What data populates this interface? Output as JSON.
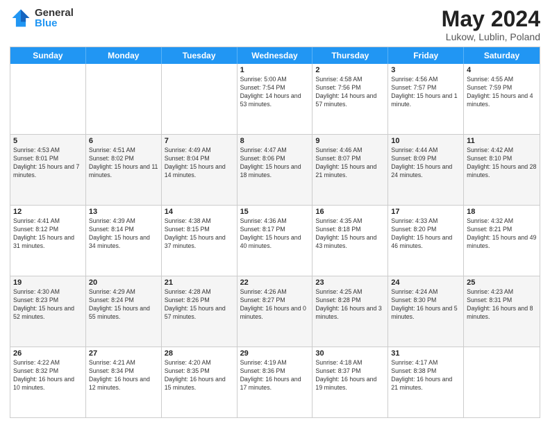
{
  "header": {
    "logo_general": "General",
    "logo_blue": "Blue",
    "title": "May 2024",
    "location": "Lukow, Lublin, Poland"
  },
  "days_of_week": [
    "Sunday",
    "Monday",
    "Tuesday",
    "Wednesday",
    "Thursday",
    "Friday",
    "Saturday"
  ],
  "rows": [
    {
      "alt": false,
      "cells": [
        {
          "num": "",
          "sunrise": "",
          "sunset": "",
          "daylight": ""
        },
        {
          "num": "",
          "sunrise": "",
          "sunset": "",
          "daylight": ""
        },
        {
          "num": "",
          "sunrise": "",
          "sunset": "",
          "daylight": ""
        },
        {
          "num": "1",
          "sunrise": "Sunrise: 5:00 AM",
          "sunset": "Sunset: 7:54 PM",
          "daylight": "Daylight: 14 hours and 53 minutes."
        },
        {
          "num": "2",
          "sunrise": "Sunrise: 4:58 AM",
          "sunset": "Sunset: 7:56 PM",
          "daylight": "Daylight: 14 hours and 57 minutes."
        },
        {
          "num": "3",
          "sunrise": "Sunrise: 4:56 AM",
          "sunset": "Sunset: 7:57 PM",
          "daylight": "Daylight: 15 hours and 1 minute."
        },
        {
          "num": "4",
          "sunrise": "Sunrise: 4:55 AM",
          "sunset": "Sunset: 7:59 PM",
          "daylight": "Daylight: 15 hours and 4 minutes."
        }
      ]
    },
    {
      "alt": true,
      "cells": [
        {
          "num": "5",
          "sunrise": "Sunrise: 4:53 AM",
          "sunset": "Sunset: 8:01 PM",
          "daylight": "Daylight: 15 hours and 7 minutes."
        },
        {
          "num": "6",
          "sunrise": "Sunrise: 4:51 AM",
          "sunset": "Sunset: 8:02 PM",
          "daylight": "Daylight: 15 hours and 11 minutes."
        },
        {
          "num": "7",
          "sunrise": "Sunrise: 4:49 AM",
          "sunset": "Sunset: 8:04 PM",
          "daylight": "Daylight: 15 hours and 14 minutes."
        },
        {
          "num": "8",
          "sunrise": "Sunrise: 4:47 AM",
          "sunset": "Sunset: 8:06 PM",
          "daylight": "Daylight: 15 hours and 18 minutes."
        },
        {
          "num": "9",
          "sunrise": "Sunrise: 4:46 AM",
          "sunset": "Sunset: 8:07 PM",
          "daylight": "Daylight: 15 hours and 21 minutes."
        },
        {
          "num": "10",
          "sunrise": "Sunrise: 4:44 AM",
          "sunset": "Sunset: 8:09 PM",
          "daylight": "Daylight: 15 hours and 24 minutes."
        },
        {
          "num": "11",
          "sunrise": "Sunrise: 4:42 AM",
          "sunset": "Sunset: 8:10 PM",
          "daylight": "Daylight: 15 hours and 28 minutes."
        }
      ]
    },
    {
      "alt": false,
      "cells": [
        {
          "num": "12",
          "sunrise": "Sunrise: 4:41 AM",
          "sunset": "Sunset: 8:12 PM",
          "daylight": "Daylight: 15 hours and 31 minutes."
        },
        {
          "num": "13",
          "sunrise": "Sunrise: 4:39 AM",
          "sunset": "Sunset: 8:14 PM",
          "daylight": "Daylight: 15 hours and 34 minutes."
        },
        {
          "num": "14",
          "sunrise": "Sunrise: 4:38 AM",
          "sunset": "Sunset: 8:15 PM",
          "daylight": "Daylight: 15 hours and 37 minutes."
        },
        {
          "num": "15",
          "sunrise": "Sunrise: 4:36 AM",
          "sunset": "Sunset: 8:17 PM",
          "daylight": "Daylight: 15 hours and 40 minutes."
        },
        {
          "num": "16",
          "sunrise": "Sunrise: 4:35 AM",
          "sunset": "Sunset: 8:18 PM",
          "daylight": "Daylight: 15 hours and 43 minutes."
        },
        {
          "num": "17",
          "sunrise": "Sunrise: 4:33 AM",
          "sunset": "Sunset: 8:20 PM",
          "daylight": "Daylight: 15 hours and 46 minutes."
        },
        {
          "num": "18",
          "sunrise": "Sunrise: 4:32 AM",
          "sunset": "Sunset: 8:21 PM",
          "daylight": "Daylight: 15 hours and 49 minutes."
        }
      ]
    },
    {
      "alt": true,
      "cells": [
        {
          "num": "19",
          "sunrise": "Sunrise: 4:30 AM",
          "sunset": "Sunset: 8:23 PM",
          "daylight": "Daylight: 15 hours and 52 minutes."
        },
        {
          "num": "20",
          "sunrise": "Sunrise: 4:29 AM",
          "sunset": "Sunset: 8:24 PM",
          "daylight": "Daylight: 15 hours and 55 minutes."
        },
        {
          "num": "21",
          "sunrise": "Sunrise: 4:28 AM",
          "sunset": "Sunset: 8:26 PM",
          "daylight": "Daylight: 15 hours and 57 minutes."
        },
        {
          "num": "22",
          "sunrise": "Sunrise: 4:26 AM",
          "sunset": "Sunset: 8:27 PM",
          "daylight": "Daylight: 16 hours and 0 minutes."
        },
        {
          "num": "23",
          "sunrise": "Sunrise: 4:25 AM",
          "sunset": "Sunset: 8:28 PM",
          "daylight": "Daylight: 16 hours and 3 minutes."
        },
        {
          "num": "24",
          "sunrise": "Sunrise: 4:24 AM",
          "sunset": "Sunset: 8:30 PM",
          "daylight": "Daylight: 16 hours and 5 minutes."
        },
        {
          "num": "25",
          "sunrise": "Sunrise: 4:23 AM",
          "sunset": "Sunset: 8:31 PM",
          "daylight": "Daylight: 16 hours and 8 minutes."
        }
      ]
    },
    {
      "alt": false,
      "cells": [
        {
          "num": "26",
          "sunrise": "Sunrise: 4:22 AM",
          "sunset": "Sunset: 8:32 PM",
          "daylight": "Daylight: 16 hours and 10 minutes."
        },
        {
          "num": "27",
          "sunrise": "Sunrise: 4:21 AM",
          "sunset": "Sunset: 8:34 PM",
          "daylight": "Daylight: 16 hours and 12 minutes."
        },
        {
          "num": "28",
          "sunrise": "Sunrise: 4:20 AM",
          "sunset": "Sunset: 8:35 PM",
          "daylight": "Daylight: 16 hours and 15 minutes."
        },
        {
          "num": "29",
          "sunrise": "Sunrise: 4:19 AM",
          "sunset": "Sunset: 8:36 PM",
          "daylight": "Daylight: 16 hours and 17 minutes."
        },
        {
          "num": "30",
          "sunrise": "Sunrise: 4:18 AM",
          "sunset": "Sunset: 8:37 PM",
          "daylight": "Daylight: 16 hours and 19 minutes."
        },
        {
          "num": "31",
          "sunrise": "Sunrise: 4:17 AM",
          "sunset": "Sunset: 8:38 PM",
          "daylight": "Daylight: 16 hours and 21 minutes."
        },
        {
          "num": "",
          "sunrise": "",
          "sunset": "",
          "daylight": ""
        }
      ]
    }
  ]
}
